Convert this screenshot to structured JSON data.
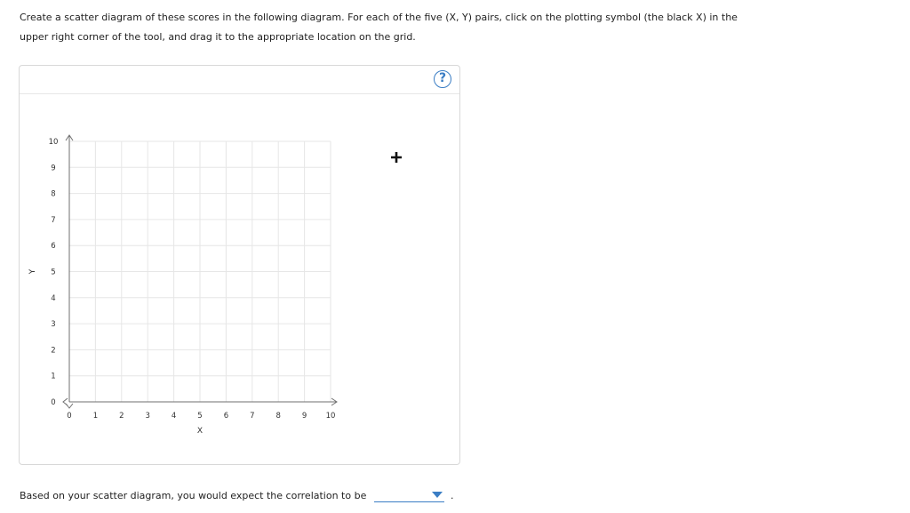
{
  "instructions": {
    "line1": "Create a scatter diagram of these scores in the following diagram. For each of the five (X, Y) pairs, click on the plotting symbol (the black X) in the",
    "line2": "upper right corner of the tool, and drag it to the appropriate location on the grid."
  },
  "tool": {
    "help_label": "?",
    "plot_symbol_icon": "plus-icon"
  },
  "chart_data": {
    "type": "scatter",
    "xlabel": "X",
    "ylabel": "Y",
    "xlim": [
      0,
      10
    ],
    "ylim": [
      0,
      10
    ],
    "x_ticks": [
      "0",
      "1",
      "2",
      "3",
      "4",
      "5",
      "6",
      "7",
      "8",
      "9",
      "10"
    ],
    "y_ticks": [
      "0",
      "1",
      "2",
      "3",
      "4",
      "5",
      "6",
      "7",
      "8",
      "9",
      "10"
    ],
    "grid": true,
    "points": []
  },
  "question": {
    "text": "Based on your scatter diagram, you would expect the correlation to be",
    "dropdown_value": "",
    "trailing": "."
  },
  "colors": {
    "accent": "#3a7dc4",
    "grid": "#e6e6e6",
    "axis": "#6f6f6f"
  }
}
